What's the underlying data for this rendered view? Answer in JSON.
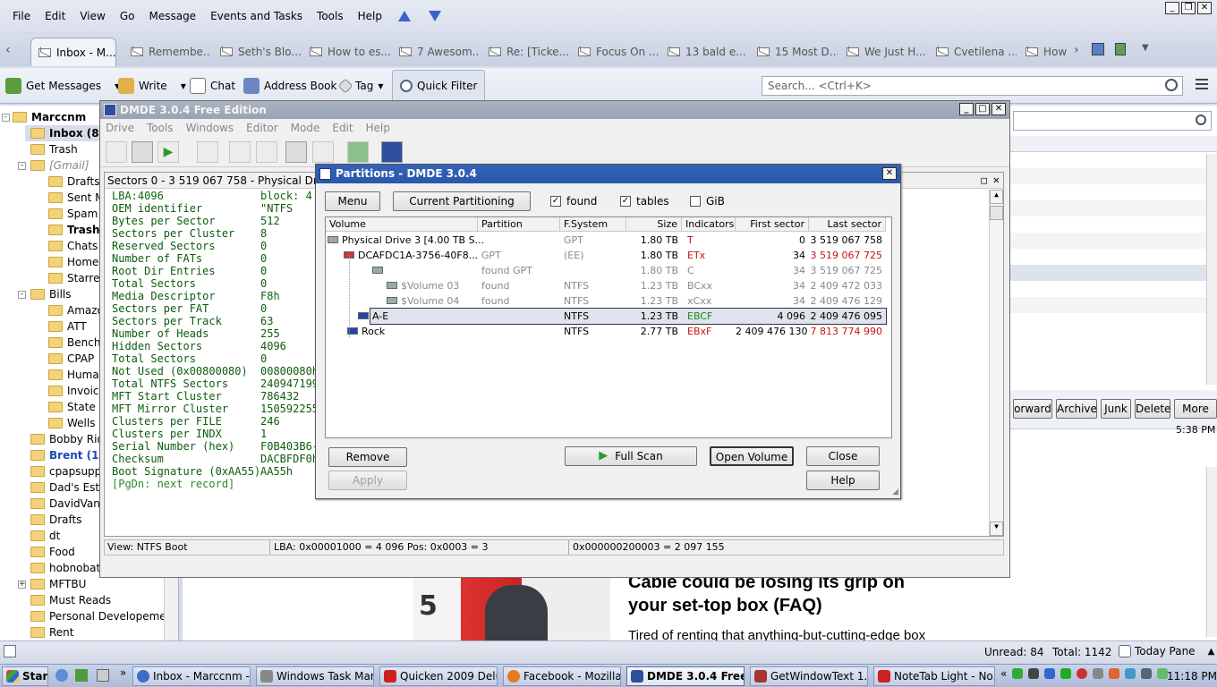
{
  "thunderbird": {
    "menu": [
      "File",
      "Edit",
      "View",
      "Go",
      "Message",
      "Events and Tasks",
      "Tools",
      "Help"
    ],
    "tabs": [
      "Inbox - M...",
      "Remembe...",
      "Seth's Blo...",
      "How to es...",
      "7 Awesom...",
      "Re: [Ticke...",
      "Focus On ...",
      "13 bald e...",
      "15 Most D...",
      "We Just H...",
      "Cvetilena ...",
      "How"
    ],
    "toolbar": {
      "get_messages": "Get Messages",
      "write": "Write",
      "chat": "Chat",
      "address_book": "Address Book",
      "tag": "Tag",
      "quick_filter": "Quick Filter"
    },
    "search_placeholder": "Search... <Ctrl+K>",
    "folders": [
      {
        "label": "Marccnm",
        "bold": true
      },
      {
        "label": "Inbox (84",
        "bold": true
      },
      {
        "label": "Trash"
      },
      {
        "label": "[Gmail]",
        "italic": true
      },
      {
        "label": "Drafts"
      },
      {
        "label": "Sent Ma"
      },
      {
        "label": "Spam"
      },
      {
        "label": "Trash (",
        "bold": true
      },
      {
        "label": "Chats"
      },
      {
        "label": "Home H"
      },
      {
        "label": "Starred"
      },
      {
        "label": "Bills"
      },
      {
        "label": "Amazon"
      },
      {
        "label": "ATT"
      },
      {
        "label": "BenchM"
      },
      {
        "label": "CPAP"
      },
      {
        "label": "Humana"
      },
      {
        "label": "Invoices"
      },
      {
        "label": "State Fa"
      },
      {
        "label": "Wells Fa"
      },
      {
        "label": "Bobby Rio"
      },
      {
        "label": "Brent (1)",
        "blue": true
      },
      {
        "label": "cpapsupply"
      },
      {
        "label": "Dad's Estate"
      },
      {
        "label": "DavidVanAr"
      },
      {
        "label": "Drafts"
      },
      {
        "label": "dt"
      },
      {
        "label": "Food"
      },
      {
        "label": "hobnobatla"
      },
      {
        "label": "MFTBU"
      },
      {
        "label": "Must Reads"
      },
      {
        "label": "Personal Developement"
      },
      {
        "label": "Rent"
      }
    ],
    "msg_actions": [
      "orward",
      "Archive",
      "Junk",
      "Delete",
      "More"
    ],
    "msg_time": "5:38 PM",
    "article_title_line1": "Cable could be losing its grip on",
    "article_title_line2": "your set-top box (FAQ)",
    "article_sub": "Tired of renting that anything-but-cutting-edge box",
    "article_badge": "5",
    "status": {
      "unread": "Unread: 84",
      "total": "Total: 1142",
      "today": "Today Pane"
    }
  },
  "taskbar": {
    "start": "Start",
    "items": [
      "Inbox - Marccnm - ...",
      "Windows Task Man...",
      "Quicken 2009 Delux...",
      "Facebook - Mozilla ...",
      "DMDE 3.0.4 Free ...",
      "GetWindowText 1.61",
      "NoteTab Light  - No..."
    ],
    "clock": "11:18 PM"
  },
  "dmde": {
    "title": "DMDE 3.0.4 Free Edition",
    "menu": [
      "Drive",
      "Tools",
      "Windows",
      "Editor",
      "Mode",
      "Edit",
      "Help"
    ],
    "panel_title": "Sectors 0 - 3 519 067 758 - Physical Drive 3 [4.0",
    "lba_line": {
      "left": "LBA:4096",
      "right": "block: 4  0"
    },
    "fields": [
      [
        "OEM identifier",
        "\"NTFS    \""
      ],
      [
        "Bytes per Sector",
        "512"
      ],
      [
        "Sectors per Cluster",
        "8"
      ],
      [
        "Reserved Sectors",
        "0"
      ],
      [
        "Number of FATs",
        "0"
      ],
      [
        "Root Dir Entries",
        "0"
      ],
      [
        "Total Sectors",
        "0"
      ],
      [
        "Media Descriptor",
        "F8h"
      ],
      [
        "Sectors per FAT",
        "0"
      ],
      [
        "Sectors per Track",
        "63"
      ],
      [
        "Number of Heads",
        "255"
      ],
      [
        "Hidden Sectors",
        "4096"
      ],
      [
        "Total Sectors",
        "0"
      ],
      [
        "Not Used (0x00800080)",
        "00800080h"
      ],
      [
        "Total NTFS Sectors",
        "240947199"
      ],
      [
        "MFT Start Cluster",
        "786432"
      ],
      [
        "MFT Mirror Cluster",
        "150592255"
      ],
      [
        "Clusters per FILE",
        "246"
      ],
      [
        "Clusters per INDX",
        "1"
      ],
      [
        "Serial Number (hex)",
        "F0B403B6-"
      ],
      [
        "Checksum",
        "DACBFDF0h"
      ],
      [
        "Boot Signature (0xAA55)",
        "AA55h"
      ]
    ],
    "next_record": "[PgDn: next record]",
    "status": {
      "view": "View:   NTFS Boot",
      "lba": "LBA: 0x00001000 = 4 096  Pos: 0x0003 = 3",
      "offset": "0x000000200003 = 2 097 155"
    }
  },
  "partitions": {
    "title": "Partitions - DMDE 3.0.4",
    "menu_btn": "Menu",
    "current_btn": "Current Partitioning",
    "checks": [
      {
        "label": "found",
        "checked": true
      },
      {
        "label": "tables",
        "checked": true
      },
      {
        "label": "GiB",
        "checked": false
      }
    ],
    "columns": [
      "Volume",
      "Partition",
      "F.System",
      "Size",
      "Indicators",
      "First sector",
      "Last sector"
    ],
    "rows": [
      {
        "volume": "Physical Drive 3 [4.00 TB S...",
        "partition": "",
        "fs": "GPT",
        "size": "1.80 TB",
        "ind": "T",
        "first": "0",
        "last": "3 519 067 758"
      },
      {
        "volume": "DCAFDC1A-3756-40F8...",
        "partition": "GPT",
        "fs": "(EE)",
        "size": "1.80 TB",
        "ind": "ETx",
        "first": "34",
        "last": "3 519 067 725"
      },
      {
        "volume": "",
        "partition": "found GPT",
        "fs": "",
        "size": "1.80 TB",
        "ind": "C",
        "first": "34",
        "last": "3 519 067 725"
      },
      {
        "volume": "$Volume 03",
        "partition": "found",
        "fs": "NTFS",
        "size": "1.23 TB",
        "ind": "BCxx",
        "first": "34",
        "last": "2 409 472 033"
      },
      {
        "volume": "$Volume 04",
        "partition": "found",
        "fs": "NTFS",
        "size": "1.23 TB",
        "ind": "xCxx",
        "first": "34",
        "last": "2 409 476 129"
      },
      {
        "volume": "A-E",
        "partition": "",
        "fs": "NTFS",
        "size": "1.23 TB",
        "ind": "EBCF",
        "first": "4 096",
        "last": "2 409 476 095"
      },
      {
        "volume": "Rock",
        "partition": "",
        "fs": "NTFS",
        "size": "2.77 TB",
        "ind": "EBxF",
        "first": "2 409 476 130",
        "last": "7 813 774 990"
      }
    ],
    "buttons": {
      "remove": "Remove",
      "apply": "Apply",
      "full_scan": "Full Scan",
      "open_volume": "Open Volume",
      "close": "Close",
      "help": "Help"
    }
  }
}
